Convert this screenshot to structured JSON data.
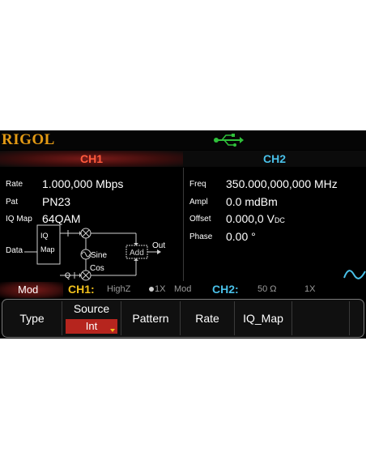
{
  "brand": {
    "logo": "RIGOL",
    "accent": "#e39a14"
  },
  "tabs": {
    "ch1": "CH1",
    "ch2": "CH2"
  },
  "left_panel": {
    "rate_label": "Rate",
    "rate_value": "1.000,000 Mbps",
    "pat_label": "Pat",
    "pat_value": "PN23",
    "iqmap_label": "IQ Map",
    "iqmap_value": "64QAM"
  },
  "diagram": {
    "data": "Data",
    "iq": "IQ",
    "map": "Map",
    "sine": "Sine",
    "cos": "Cos",
    "q": "Q",
    "add": "Add",
    "out": "Out"
  },
  "right_panel": {
    "freq_label": "Freq",
    "freq_value": "350.000,000,000 MHz",
    "ampl_label": "Ampl",
    "ampl_value": "0.0 mdBm",
    "offset_label": "Offset",
    "offset_value": "0.000,0 V",
    "offset_unit_sub": "DC",
    "phase_label": "Phase",
    "phase_value": "0.00 °"
  },
  "status": {
    "mode": "Mod",
    "ch1_label": "CH1:",
    "ch1_impedance": "HighZ",
    "ch1_mult": "1X",
    "ch1_mode": "Mod",
    "ch2_label": "CH2:",
    "ch2_impedance": "50 Ω",
    "ch2_mult": "1X"
  },
  "softkeys": {
    "type": "Type",
    "source_title": "Source",
    "source_value": "Int",
    "pattern": "Pattern",
    "rate": "Rate",
    "iq_map": "IQ_Map"
  },
  "colors": {
    "ch1": "#ff5a3c",
    "ch2": "#49c0e8",
    "status_ch1": "#f2c11c",
    "usb": "#2fbf3a",
    "selected": "#b6251e"
  }
}
